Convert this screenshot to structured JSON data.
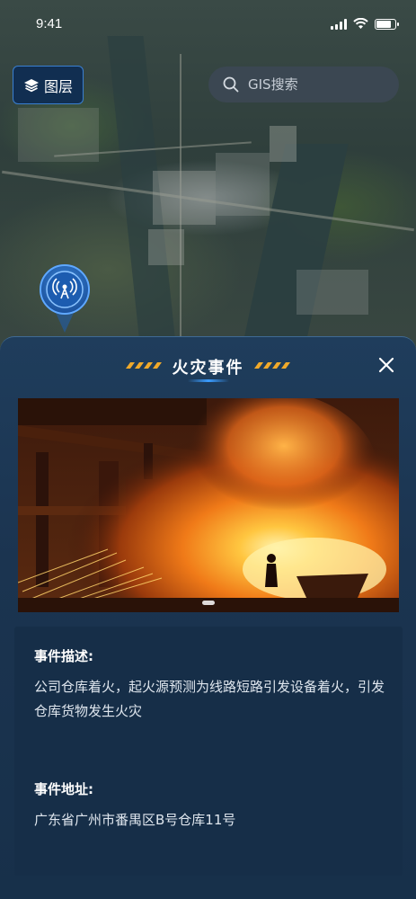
{
  "status_bar": {
    "time": "9:41"
  },
  "map": {
    "layer_button_label": "图层",
    "search_placeholder": "GIS搜索"
  },
  "panel": {
    "title": "火灾事件",
    "description_label": "事件描述:",
    "description_text": "公司仓库着火，起火源预测为线路短路引发设备着火，引发仓库货物发生火灾",
    "address_label": "事件地址:",
    "address_text": "广东省广州市番禺区B号仓库11号",
    "photo_count": 1
  },
  "colors": {
    "accent_blue": "#3b9cff",
    "stripe_orange": "#f0a92a",
    "panel_bg": "#1b3450"
  },
  "icons": [
    "layers-icon",
    "search-icon",
    "signal-tower-marker-icon",
    "close-icon",
    "wifi-icon",
    "cellular-signal-icon",
    "battery-icon"
  ]
}
